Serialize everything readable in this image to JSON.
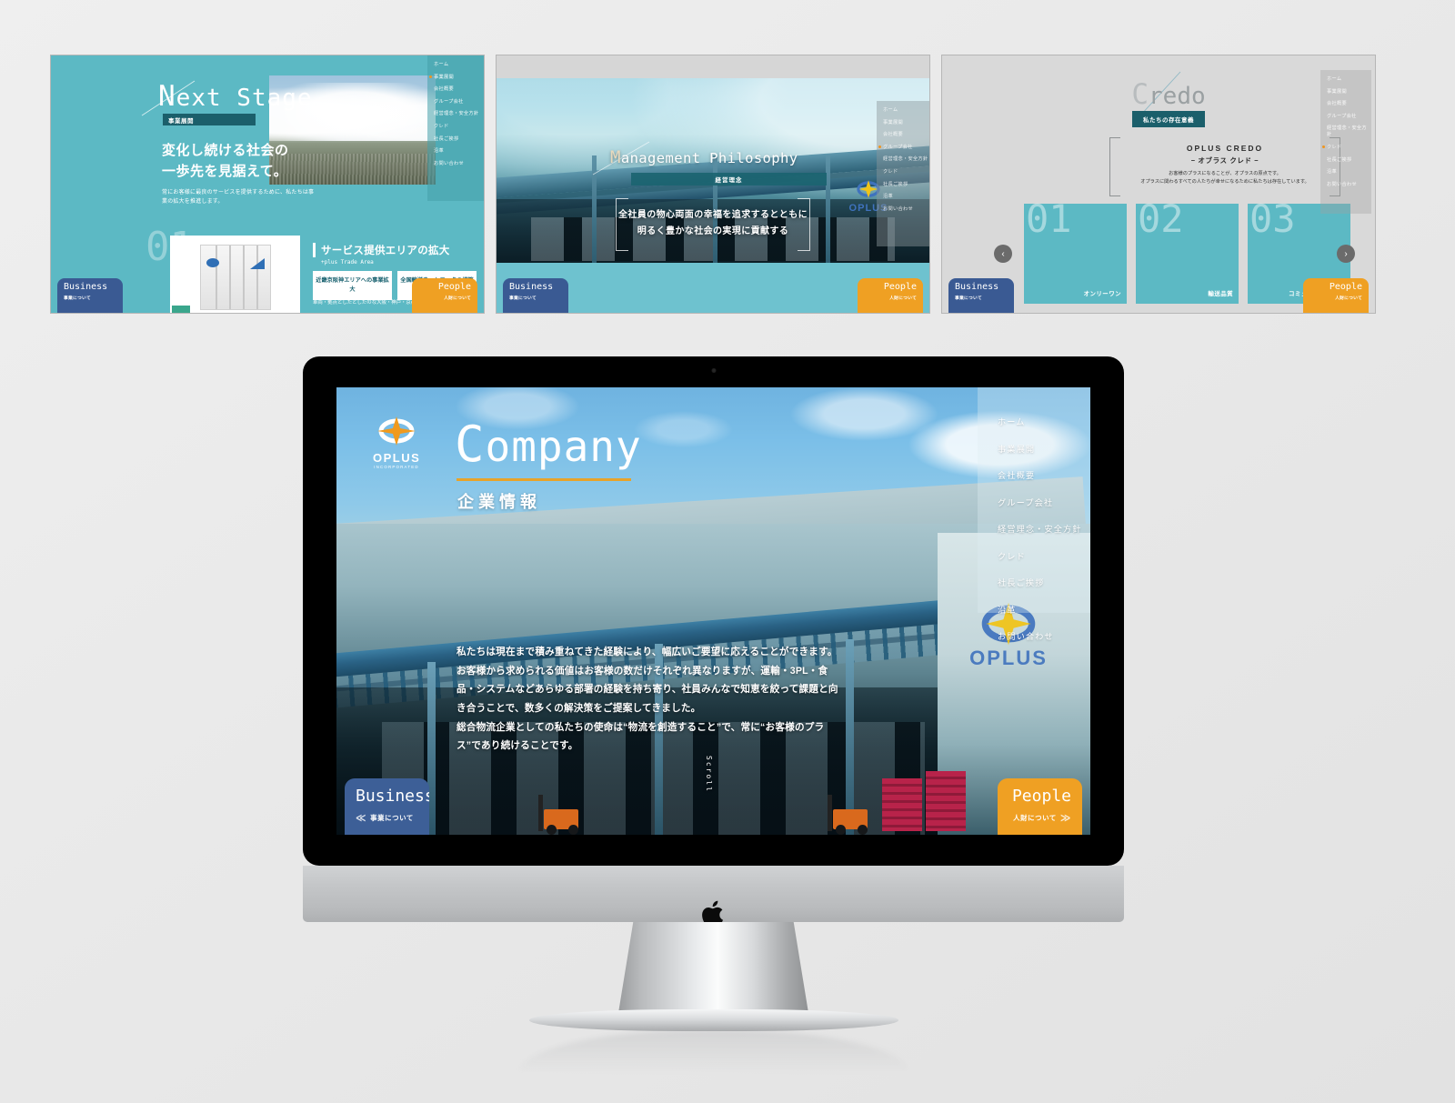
{
  "brand": {
    "name": "OPLUS",
    "tagline": "INCORPORATED"
  },
  "nav_items": [
    "ホーム",
    "事業展開",
    "会社概要",
    "グループ会社",
    "経営理念・安全方針",
    "クレド",
    "社長ご挨拶",
    "沿革",
    "お問い合わせ"
  ],
  "cta": {
    "business": {
      "title": "Business",
      "sub": "事業について",
      "color": "#3d5f97"
    },
    "people": {
      "title": "People",
      "sub": "人財について",
      "color": "#efa023"
    }
  },
  "colors": {
    "teal": "#5cb9c4",
    "deep_teal": "#1b5f6b",
    "orange": "#efa023",
    "navy": "#3d5f97",
    "gold_rule": "#e8a32a",
    "page_bg": "#ebebeb"
  },
  "main_screen": {
    "title": "Company",
    "title_initial": "C",
    "subtitle": "企業情報",
    "scroll_label": "Scroll",
    "body": [
      "私たちは現在まで積み重ねてきた経験により、幅広いご要望に応えることができます。",
      "お客様から求められる価値はお客様の数だけそれぞれ異なりますが、運輸・3PL・食品・システムなどあらゆる部署の経験を持ち寄り、社員みんなで知恵を絞って課題と向き合うことで、数多くの解決策をご提案してきました。",
      "総合物流企業としての私たちの使命は“物流を創造すること”で、常に“お客様のプラス”であり続けることです。"
    ]
  },
  "thumbnails": [
    {
      "id": "next-stage",
      "title": "Next Stage",
      "title_initial": "N",
      "badge": "事業展開",
      "heading_line1": "変化し続ける社会の",
      "heading_line2": "一歩先を見据えて。",
      "lead": "常にお客様に最良のサービスを提供するために、私たちは事業の拡大を推進します。",
      "section_number": "01",
      "section_title": "サービス提供エリアの拡大",
      "section_sub": "+plus Trade Area",
      "buttons": [
        "近畿京阪神エリアへの事業拡大",
        "全国輸送ネットワークの構築"
      ],
      "footnote": "車両・拠点としたとしたのな大阪・神戸・京都・奈良など関西圏",
      "active_nav": "事業展開"
    },
    {
      "id": "management-philosophy",
      "title": "Management Philosophy",
      "title_initial": "M",
      "badge": "経営理念",
      "slogan_line1": "全社員の物心両面の幸福を追求するとともに",
      "slogan_line2": "明るく豊かな社会の実現に貢献する",
      "active_nav": "グループ会社"
    },
    {
      "id": "credo",
      "title": "Credo",
      "title_initial": "C",
      "badge": "私たちの存在意義",
      "credo_heading": "OPLUS CREDO",
      "credo_subheading": "− オブラス クレド −",
      "credo_text_line1": "お客様のプラスになることが、オプラスの原点です。",
      "credo_text_line2": "オプラスに関わるすべての人たちが幸せになるために私たちは存在しています。",
      "cards": [
        {
          "number": "01",
          "label": "オンリーワン"
        },
        {
          "number": "02",
          "label": "輸送品質"
        },
        {
          "number": "03",
          "label": "お客様との\nコミュニケーション"
        }
      ],
      "prev_arrow": "‹",
      "next_arrow": "›",
      "active_nav": "クレド"
    }
  ],
  "device": {
    "type": "iMac",
    "logo": "apple-logo"
  }
}
